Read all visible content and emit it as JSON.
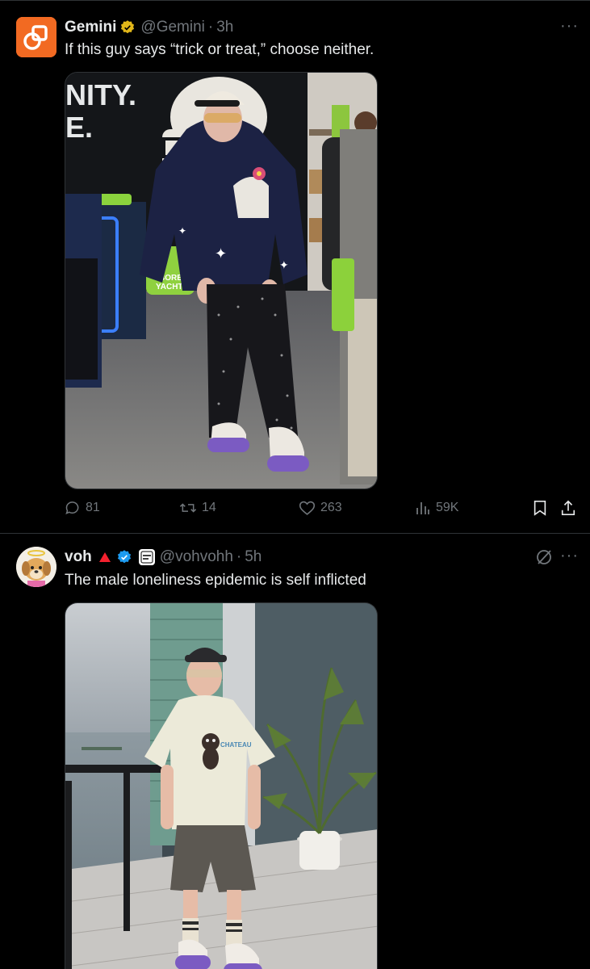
{
  "posts": [
    {
      "author": "Gemini",
      "handle": "@Gemini",
      "sep": "·",
      "time": "3h",
      "text": "If this guy says “trick or treat,” choose neither.",
      "more": "···",
      "image_signage": [
        "NITY.",
        "E.",
        "BORED",
        "YACHT C"
      ],
      "stats": {
        "replies": "81",
        "reposts": "14",
        "likes": "263",
        "views": "59K"
      }
    },
    {
      "author": "voh",
      "handle": "@vohvohh",
      "sep": "·",
      "time": "5h",
      "text": "The male loneliness epidemic is self inflicted",
      "more": "···",
      "image_signage": [
        "CHATEAU"
      ]
    }
  ],
  "colors": {
    "background": "#000000",
    "text_primary": "#e7e9ea",
    "text_secondary": "#71767b",
    "gold_badge": "#e2b719",
    "blue_badge": "#1d9bf0",
    "gemini_orange": "#f26a22",
    "divider": "#2f3336"
  },
  "icons": {
    "post1": [
      "gemini-logo-icon",
      "gold-verified-badge-icon",
      "more-icon",
      "reply-icon",
      "repost-icon",
      "like-icon",
      "views-icon",
      "bookmark-icon",
      "share-icon"
    ],
    "post2": [
      "red-triangle-icon",
      "blue-verified-badge-icon",
      "affiliate-badge-icon",
      "grok-icon",
      "more-icon"
    ]
  }
}
